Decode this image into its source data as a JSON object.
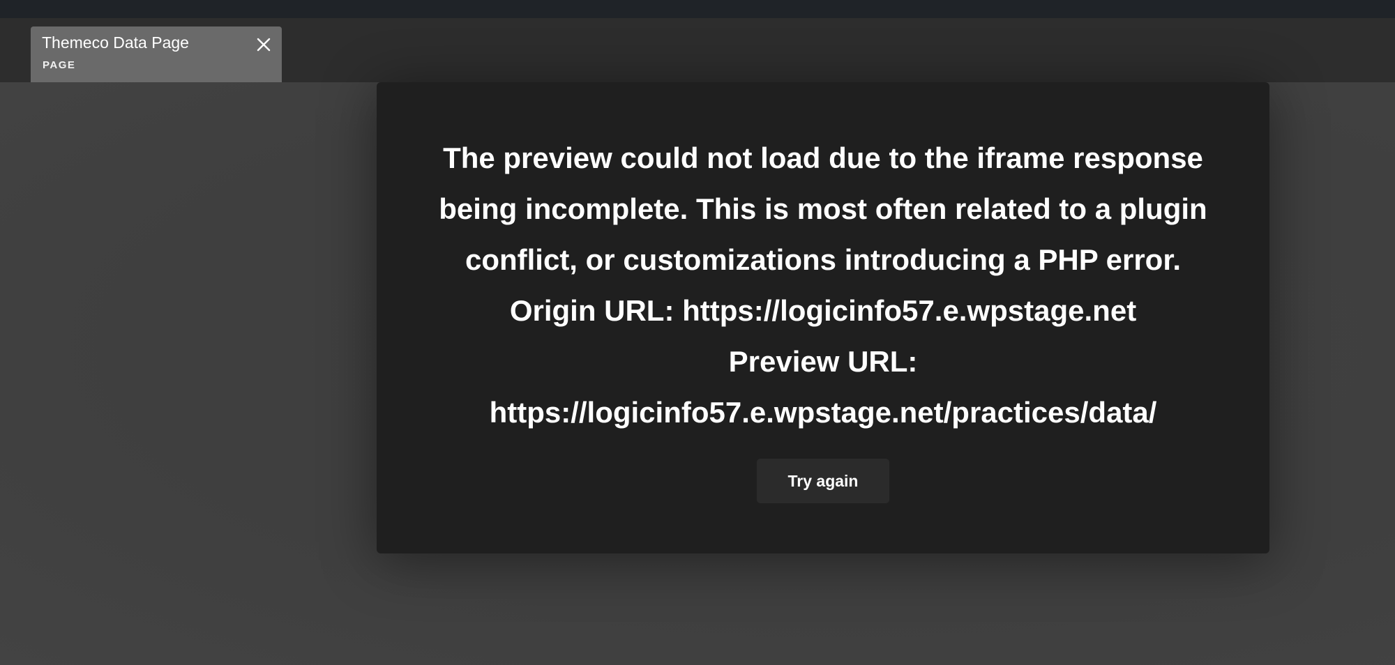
{
  "tab": {
    "title": "Themeco Data Page",
    "type_label": "PAGE",
    "close_icon": "close-icon"
  },
  "error": {
    "message": "The preview could not load due to the iframe response being incomplete. This is most often related to a plugin conflict, or customizations introducing a PHP error.",
    "origin_label": "Origin URL: https://logicinfo57.e.wpstage.net",
    "preview_label": "Preview URL:",
    "preview_url": "https://logicinfo57.e.wpstage.net/practices/data/",
    "retry_label": "Try again"
  },
  "colors": {
    "top_strip": "#1f2328",
    "tab_bar": "#2d2d2d",
    "active_tab": "#6a6a6a",
    "canvas": "#3f3f3f",
    "modal": "#1f1f1f",
    "button": "#2b2b2b"
  }
}
